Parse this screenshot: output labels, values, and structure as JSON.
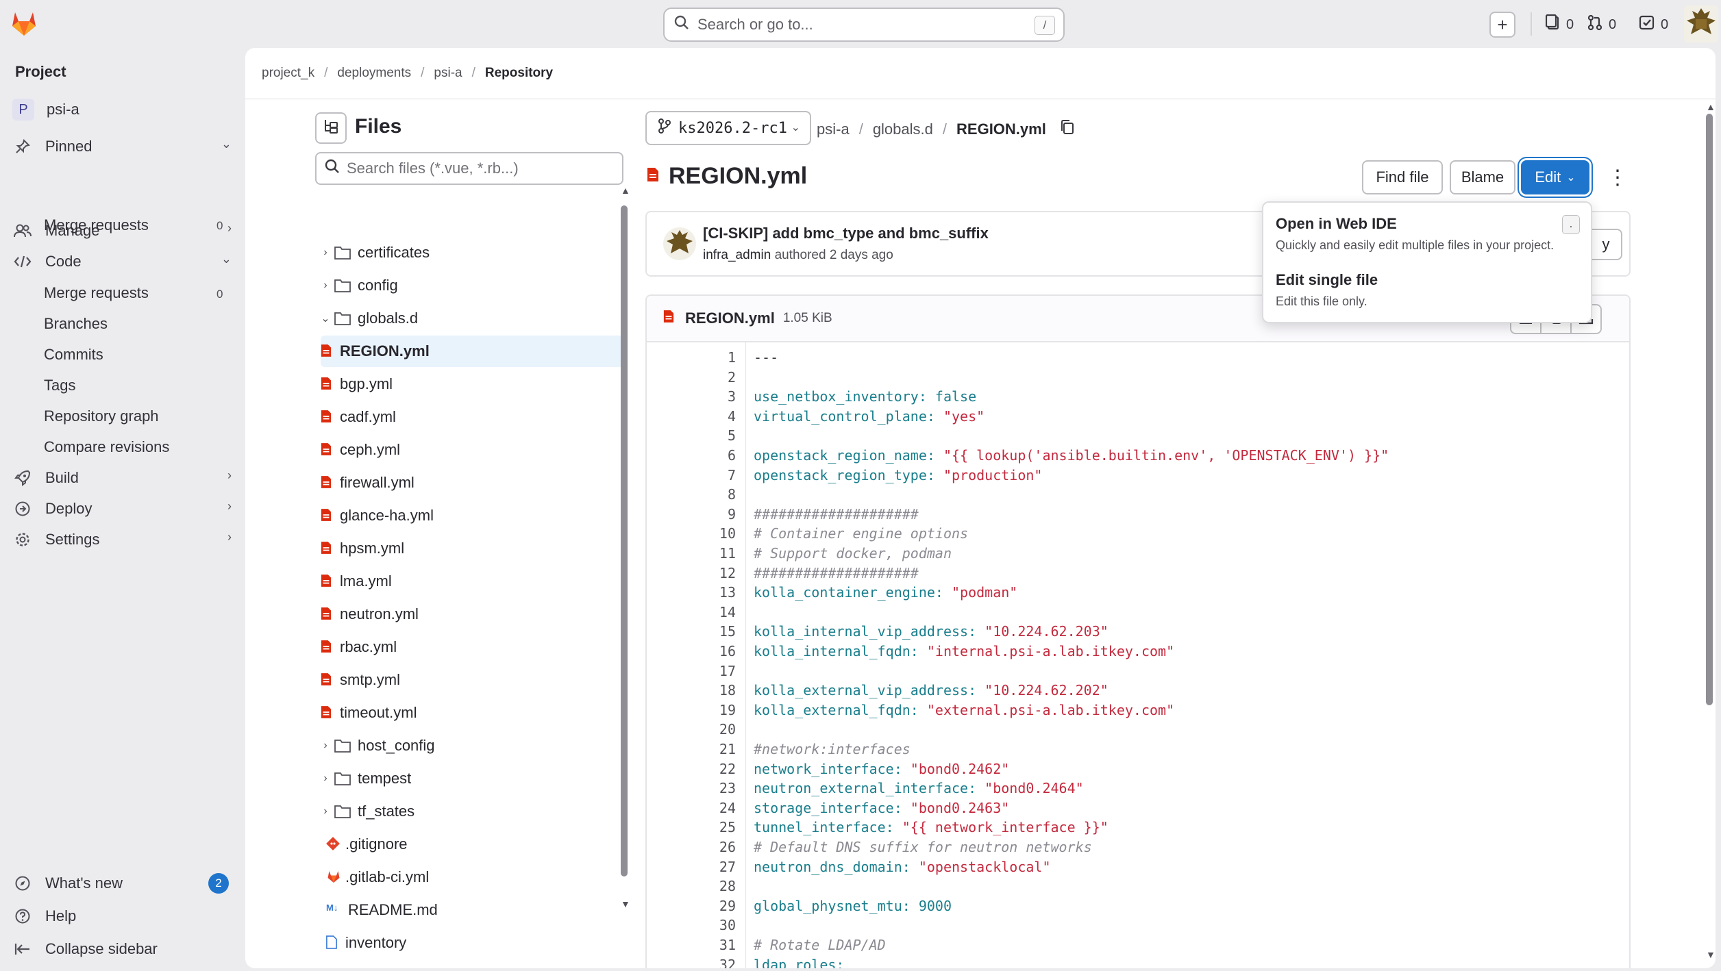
{
  "topbar": {
    "search_placeholder": "Search or go to...",
    "search_shortcut": "/",
    "issues_count": "0",
    "merge_requests_count": "0",
    "todos_count": "0"
  },
  "sidebar": {
    "section_title": "Project",
    "project_letter": "P",
    "project_name": "psi-a",
    "pinned_label": "Pinned",
    "pinned_merge_requests": "Merge requests",
    "pinned_merge_requests_count": "0",
    "manage": "Manage",
    "code": "Code",
    "code_items": [
      "Merge requests",
      "Branches",
      "Commits",
      "Tags",
      "Repository graph",
      "Compare revisions"
    ],
    "code_merge_requests_count": "0",
    "build": "Build",
    "deploy": "Deploy",
    "settings": "Settings",
    "whats_new": "What's new",
    "whats_new_count": "2",
    "help": "Help",
    "collapse": "Collapse sidebar"
  },
  "breadcrumb": [
    "project_k",
    "deployments",
    "psi-a",
    "Repository"
  ],
  "files_panel": {
    "title": "Files",
    "search_placeholder": "Search files (*.vue, *.rb...)",
    "folders_top": [
      "certificates",
      "config"
    ],
    "open_folder": "globals.d",
    "open_folder_files": [
      "REGION.yml",
      "bgp.yml",
      "cadf.yml",
      "ceph.yml",
      "firewall.yml",
      "glance-ha.yml",
      "hpsm.yml",
      "lma.yml",
      "neutron.yml",
      "rbac.yml",
      "smtp.yml",
      "timeout.yml"
    ],
    "folders_bottom": [
      "host_config",
      "tempest",
      "tf_states"
    ],
    "root_files": [
      ".gitignore",
      ".gitlab-ci.yml",
      "README.md",
      "inventory"
    ]
  },
  "ref": "ks2026.2-rc1",
  "path": [
    "psi-a",
    "globals.d",
    "REGION.yml"
  ],
  "file_title": "REGION.yml",
  "buttons": {
    "find_file": "Find file",
    "blame": "Blame",
    "edit": "Edit"
  },
  "commit": {
    "message": "[CI-SKIP] add bmc_type and bmc_suffix",
    "author": "infra_admin",
    "meta": "authored 2 days ago",
    "button_partial": "y"
  },
  "blob": {
    "filename": "REGION.yml",
    "size": "1.05 KiB"
  },
  "edit_dropdown": {
    "item1_title": "Open in Web IDE",
    "item1_desc": "Quickly and easily edit multiple files in your project.",
    "item1_shortcut": ".",
    "item2_title": "Edit single file",
    "item2_desc": "Edit this file only."
  },
  "code_lines": [
    {
      "n": "1",
      "parts": [
        [
          "p",
          "---"
        ]
      ]
    },
    {
      "n": "2",
      "parts": []
    },
    {
      "n": "3",
      "parts": [
        [
          "k",
          "use_netbox_inventory:"
        ],
        [
          "p",
          " "
        ],
        [
          "n",
          "false"
        ]
      ]
    },
    {
      "n": "4",
      "parts": [
        [
          "k",
          "virtual_control_plane:"
        ],
        [
          "p",
          " "
        ],
        [
          "s",
          "\"yes\""
        ]
      ]
    },
    {
      "n": "5",
      "parts": []
    },
    {
      "n": "6",
      "parts": [
        [
          "k",
          "openstack_region_name:"
        ],
        [
          "p",
          " "
        ],
        [
          "s",
          "\"{{ lookup('ansible.builtin.env', 'OPENSTACK_ENV') }}\""
        ]
      ]
    },
    {
      "n": "7",
      "parts": [
        [
          "k",
          "openstack_region_type:"
        ],
        [
          "p",
          " "
        ],
        [
          "s",
          "\"production\""
        ]
      ]
    },
    {
      "n": "8",
      "parts": []
    },
    {
      "n": "9",
      "parts": [
        [
          "c",
          "####################"
        ]
      ]
    },
    {
      "n": "10",
      "parts": [
        [
          "c",
          "# Container engine options"
        ]
      ]
    },
    {
      "n": "11",
      "parts": [
        [
          "c",
          "# Support docker, podman"
        ]
      ]
    },
    {
      "n": "12",
      "parts": [
        [
          "c",
          "####################"
        ]
      ]
    },
    {
      "n": "13",
      "parts": [
        [
          "k",
          "kolla_container_engine:"
        ],
        [
          "p",
          " "
        ],
        [
          "s",
          "\"podman\""
        ]
      ]
    },
    {
      "n": "14",
      "parts": []
    },
    {
      "n": "15",
      "parts": [
        [
          "k",
          "kolla_internal_vip_address:"
        ],
        [
          "p",
          " "
        ],
        [
          "s",
          "\"10.224.62.203\""
        ]
      ]
    },
    {
      "n": "16",
      "parts": [
        [
          "k",
          "kolla_internal_fqdn:"
        ],
        [
          "p",
          " "
        ],
        [
          "s",
          "\"internal.psi-a.lab.itkey.com\""
        ]
      ]
    },
    {
      "n": "17",
      "parts": []
    },
    {
      "n": "18",
      "parts": [
        [
          "k",
          "kolla_external_vip_address:"
        ],
        [
          "p",
          " "
        ],
        [
          "s",
          "\"10.224.62.202\""
        ]
      ]
    },
    {
      "n": "19",
      "parts": [
        [
          "k",
          "kolla_external_fqdn:"
        ],
        [
          "p",
          " "
        ],
        [
          "s",
          "\"external.psi-a.lab.itkey.com\""
        ]
      ]
    },
    {
      "n": "20",
      "parts": []
    },
    {
      "n": "21",
      "parts": [
        [
          "c",
          "#network:interfaces"
        ]
      ]
    },
    {
      "n": "22",
      "parts": [
        [
          "k",
          "network_interface:"
        ],
        [
          "p",
          " "
        ],
        [
          "s",
          "\"bond0.2462\""
        ]
      ]
    },
    {
      "n": "23",
      "parts": [
        [
          "k",
          "neutron_external_interface:"
        ],
        [
          "p",
          " "
        ],
        [
          "s",
          "\"bond0.2464\""
        ]
      ]
    },
    {
      "n": "24",
      "parts": [
        [
          "k",
          "storage_interface:"
        ],
        [
          "p",
          " "
        ],
        [
          "s",
          "\"bond0.2463\""
        ]
      ]
    },
    {
      "n": "25",
      "parts": [
        [
          "k",
          "tunnel_interface:"
        ],
        [
          "p",
          " "
        ],
        [
          "s",
          "\"{{ network_interface }}\""
        ]
      ]
    },
    {
      "n": "26",
      "parts": [
        [
          "c",
          "# Default DNS suffix for neutron networks"
        ]
      ]
    },
    {
      "n": "27",
      "parts": [
        [
          "k",
          "neutron_dns_domain:"
        ],
        [
          "p",
          " "
        ],
        [
          "s",
          "\"openstacklocal\""
        ]
      ]
    },
    {
      "n": "28",
      "parts": []
    },
    {
      "n": "29",
      "parts": [
        [
          "k",
          "global_physnet_mtu:"
        ],
        [
          "p",
          " "
        ],
        [
          "n",
          "9000"
        ]
      ]
    },
    {
      "n": "30",
      "parts": []
    },
    {
      "n": "31",
      "parts": [
        [
          "c",
          "# Rotate LDAP/AD"
        ]
      ]
    },
    {
      "n": "32",
      "parts": [
        [
          "k",
          "ldap_roles:"
        ]
      ]
    }
  ]
}
